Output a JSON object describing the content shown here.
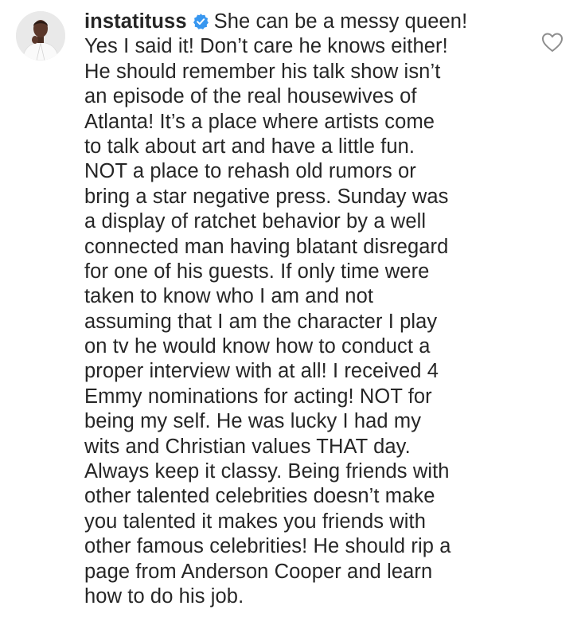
{
  "comment": {
    "username": "instatituss",
    "verified_icon": "verified-badge-icon",
    "like_icon": "heart-outline-icon",
    "avatar_icon": "profile-avatar",
    "accent_color": "#3897f0",
    "first_line_text": "She can be a messy queen!",
    "lines": [
      "Yes I said it! Don’t care he knows either!",
      "He should remember his talk show isn’t",
      "an episode of the real housewives of",
      "Atlanta! It’s a place where artists come",
      "to talk about art and have a little fun.",
      "NOT a place to rehash old rumors or",
      "bring a star negative press. Sunday was",
      "a display of ratchet behavior by a well",
      "connected man having blatant disregard",
      "for one of his guests. If only time were",
      "taken to know who I am and not",
      "assuming that I am the character I play",
      "on tv he would know how to conduct a",
      "proper interview with at all! I received 4",
      "Emmy nominations for acting! NOT for",
      "being my self. He was lucky I had my",
      "wits and Christian values THAT day.",
      "Always keep it classy. Being friends with",
      "other talented celebrities doesn’t make",
      "you talented it makes you friends with",
      "other famous celebrities! He should rip a",
      "page from Anderson Cooper and learn",
      "how to do his job."
    ]
  }
}
